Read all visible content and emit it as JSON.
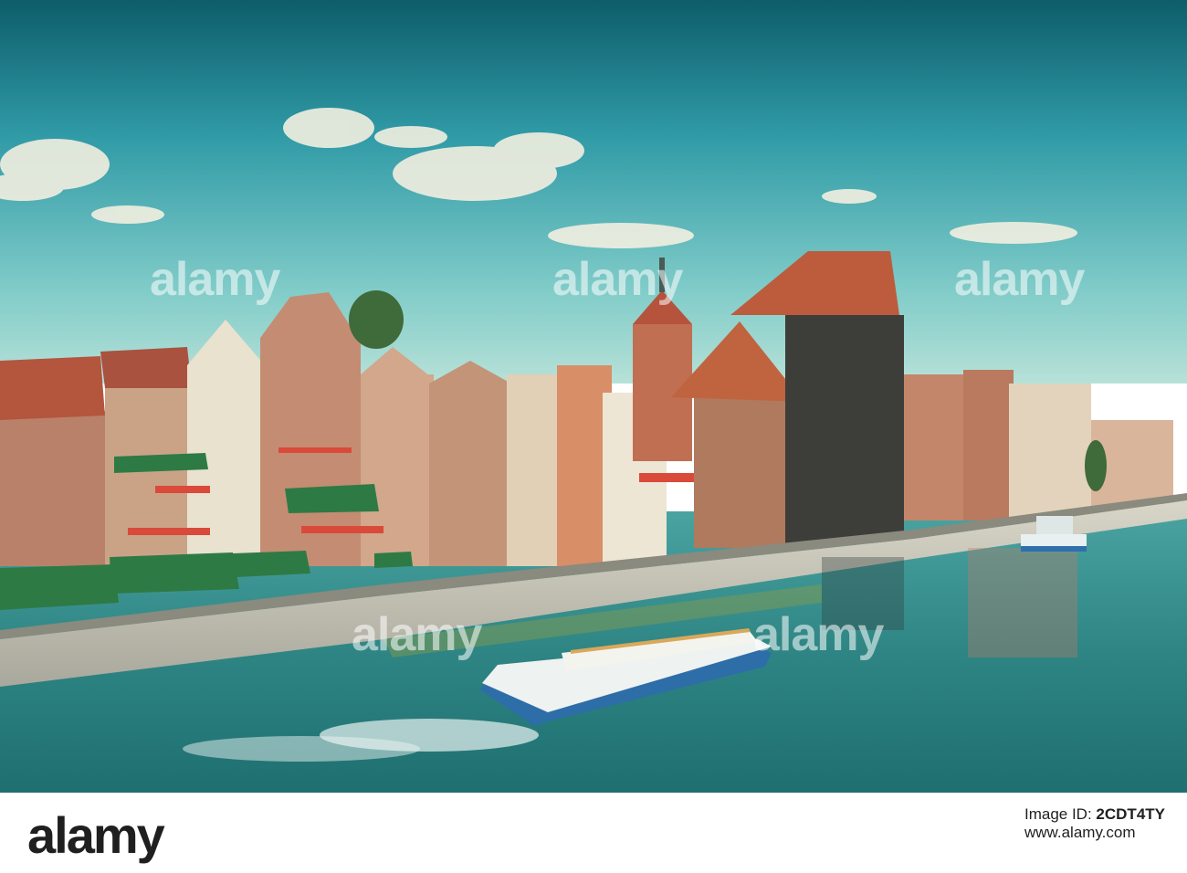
{
  "photo": {
    "description_colors": {
      "sky_top": "#0f6d7a",
      "sky_mid": "#3ea7b0",
      "sky_low": "#8ed3cf",
      "water": "#2f8f8e",
      "roof": "#b5533c",
      "brick": "#b98a6d",
      "crane_wood": "#3b3c3a",
      "awning": "#2f7f4a"
    },
    "watermarks": [
      "alamy",
      "alamy",
      "alamy",
      "alamy",
      "alamy",
      "alamy",
      "alamy",
      "alamy"
    ]
  },
  "footer": {
    "logo": "alamy",
    "image_id_label": "Image ID:",
    "image_id": "2CDT4TY",
    "site": "www.alamy.com"
  }
}
